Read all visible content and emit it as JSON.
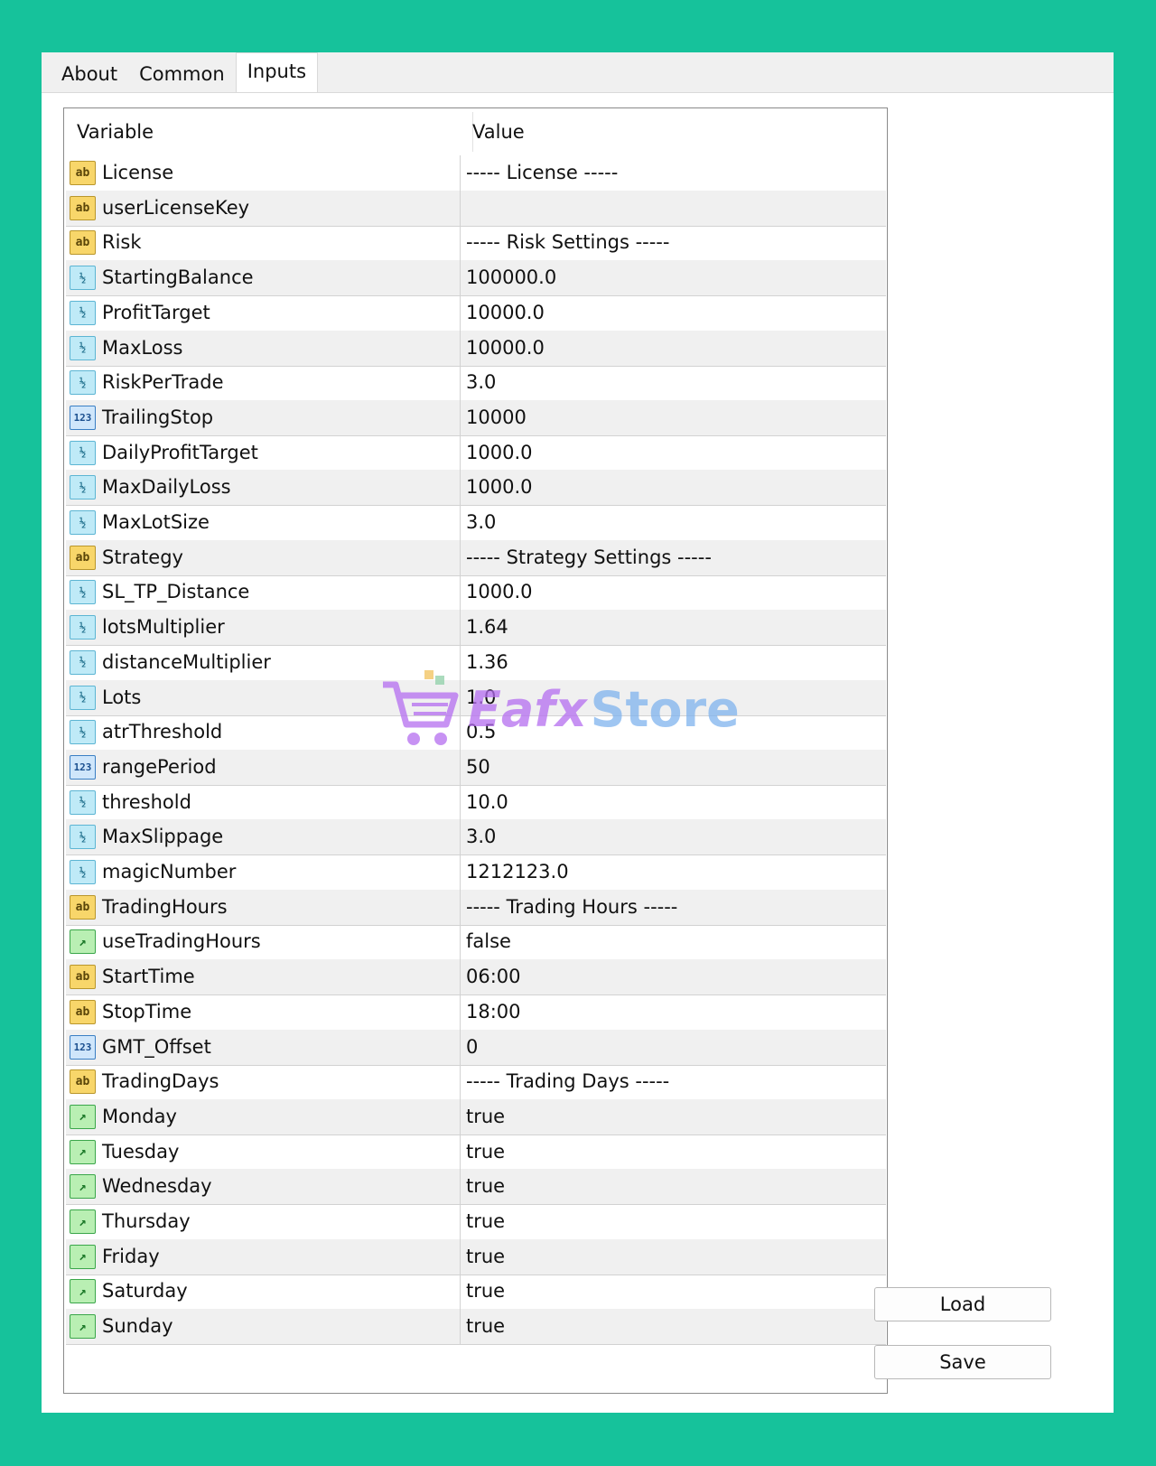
{
  "tabs": [
    {
      "label": "About"
    },
    {
      "label": "Common"
    },
    {
      "label": "Inputs"
    }
  ],
  "grid": {
    "columns": {
      "variable": "Variable",
      "value": "Value"
    },
    "rows": [
      {
        "type": "ab",
        "icon": "string-icon",
        "glyph": "ab",
        "name": "License",
        "value": "----- License -----"
      },
      {
        "type": "ab",
        "icon": "string-icon",
        "glyph": "ab",
        "name": "userLicenseKey",
        "value": ""
      },
      {
        "type": "ab",
        "icon": "string-icon",
        "glyph": "ab",
        "name": "Risk",
        "value": "----- Risk Settings -----"
      },
      {
        "type": "dbl",
        "icon": "double-icon",
        "glyph": "½",
        "name": "StartingBalance",
        "value": "100000.0"
      },
      {
        "type": "dbl",
        "icon": "double-icon",
        "glyph": "½",
        "name": "ProfitTarget",
        "value": "10000.0"
      },
      {
        "type": "dbl",
        "icon": "double-icon",
        "glyph": "½",
        "name": "MaxLoss",
        "value": "10000.0"
      },
      {
        "type": "dbl",
        "icon": "double-icon",
        "glyph": "½",
        "name": "RiskPerTrade",
        "value": "3.0"
      },
      {
        "type": "int",
        "icon": "integer-icon",
        "glyph": "123",
        "name": "TrailingStop",
        "value": "10000"
      },
      {
        "type": "dbl",
        "icon": "double-icon",
        "glyph": "½",
        "name": "DailyProfitTarget",
        "value": "1000.0"
      },
      {
        "type": "dbl",
        "icon": "double-icon",
        "glyph": "½",
        "name": "MaxDailyLoss",
        "value": "1000.0"
      },
      {
        "type": "dbl",
        "icon": "double-icon",
        "glyph": "½",
        "name": "MaxLotSize",
        "value": "3.0"
      },
      {
        "type": "ab",
        "icon": "string-icon",
        "glyph": "ab",
        "name": "Strategy",
        "value": "----- Strategy Settings -----"
      },
      {
        "type": "dbl",
        "icon": "double-icon",
        "glyph": "½",
        "name": "SL_TP_Distance",
        "value": "1000.0"
      },
      {
        "type": "dbl",
        "icon": "double-icon",
        "glyph": "½",
        "name": "lotsMultiplier",
        "value": "1.64"
      },
      {
        "type": "dbl",
        "icon": "double-icon",
        "glyph": "½",
        "name": "distanceMultiplier",
        "value": "1.36"
      },
      {
        "type": "dbl",
        "icon": "double-icon",
        "glyph": "½",
        "name": "Lots",
        "value": "1.0"
      },
      {
        "type": "dbl",
        "icon": "double-icon",
        "glyph": "½",
        "name": "atrThreshold",
        "value": "0.5"
      },
      {
        "type": "int",
        "icon": "integer-icon",
        "glyph": "123",
        "name": "rangePeriod",
        "value": "50"
      },
      {
        "type": "dbl",
        "icon": "double-icon",
        "glyph": "½",
        "name": "threshold",
        "value": "10.0"
      },
      {
        "type": "dbl",
        "icon": "double-icon",
        "glyph": "½",
        "name": "MaxSlippage",
        "value": "3.0"
      },
      {
        "type": "dbl",
        "icon": "double-icon",
        "glyph": "½",
        "name": "magicNumber",
        "value": "1212123.0"
      },
      {
        "type": "ab",
        "icon": "string-icon",
        "glyph": "ab",
        "name": "TradingHours",
        "value": "----- Trading Hours -----"
      },
      {
        "type": "bool",
        "icon": "boolean-icon",
        "glyph": "↗",
        "name": "useTradingHours",
        "value": "false"
      },
      {
        "type": "ab",
        "icon": "string-icon",
        "glyph": "ab",
        "name": "StartTime",
        "value": "06:00"
      },
      {
        "type": "ab",
        "icon": "string-icon",
        "glyph": "ab",
        "name": "StopTime",
        "value": "18:00"
      },
      {
        "type": "int",
        "icon": "integer-icon",
        "glyph": "123",
        "name": "GMT_Offset",
        "value": "0"
      },
      {
        "type": "ab",
        "icon": "string-icon",
        "glyph": "ab",
        "name": "TradingDays",
        "value": "----- Trading Days -----"
      },
      {
        "type": "bool",
        "icon": "boolean-icon",
        "glyph": "↗",
        "name": "Monday",
        "value": "true"
      },
      {
        "type": "bool",
        "icon": "boolean-icon",
        "glyph": "↗",
        "name": "Tuesday",
        "value": "true"
      },
      {
        "type": "bool",
        "icon": "boolean-icon",
        "glyph": "↗",
        "name": "Wednesday",
        "value": "true"
      },
      {
        "type": "bool",
        "icon": "boolean-icon",
        "glyph": "↗",
        "name": "Thursday",
        "value": "true"
      },
      {
        "type": "bool",
        "icon": "boolean-icon",
        "glyph": "↗",
        "name": "Friday",
        "value": "true"
      },
      {
        "type": "bool",
        "icon": "boolean-icon",
        "glyph": "↗",
        "name": "Saturday",
        "value": "true"
      },
      {
        "type": "bool",
        "icon": "boolean-icon",
        "glyph": "↗",
        "name": "Sunday",
        "value": "true"
      }
    ]
  },
  "buttons": {
    "load": "Load",
    "save": "Save"
  },
  "watermark": {
    "brand_a": "Eafx",
    "brand_b": "Store"
  },
  "colors": {
    "background": "#16c29b",
    "alt_row": "#f0f0f0"
  }
}
